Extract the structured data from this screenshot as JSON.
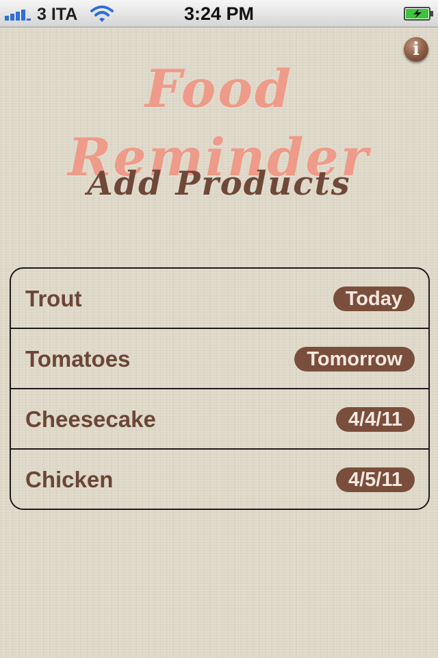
{
  "status_bar": {
    "carrier": "3 ITA",
    "time": "3:24 PM",
    "signal_bars": 4,
    "icons": [
      "signal-icon",
      "wifi-icon",
      "battery-charging-icon"
    ]
  },
  "info_button": {
    "label": "i",
    "icon": "info-icon"
  },
  "app_title": "Food Reminder",
  "section_title": "Add Products",
  "products": [
    {
      "name": "Trout",
      "date": "Today"
    },
    {
      "name": "Tomatoes",
      "date": "Tomorrow"
    },
    {
      "name": "Cheesecake",
      "date": "4/4/11"
    },
    {
      "name": "Chicken",
      "date": "4/5/11"
    }
  ],
  "colors": {
    "background": "#e0dacb",
    "title": "#ee9b89",
    "accent_brown": "#7a4e3c",
    "text_brown": "#6b4636",
    "battery_green": "#3cc43c"
  }
}
